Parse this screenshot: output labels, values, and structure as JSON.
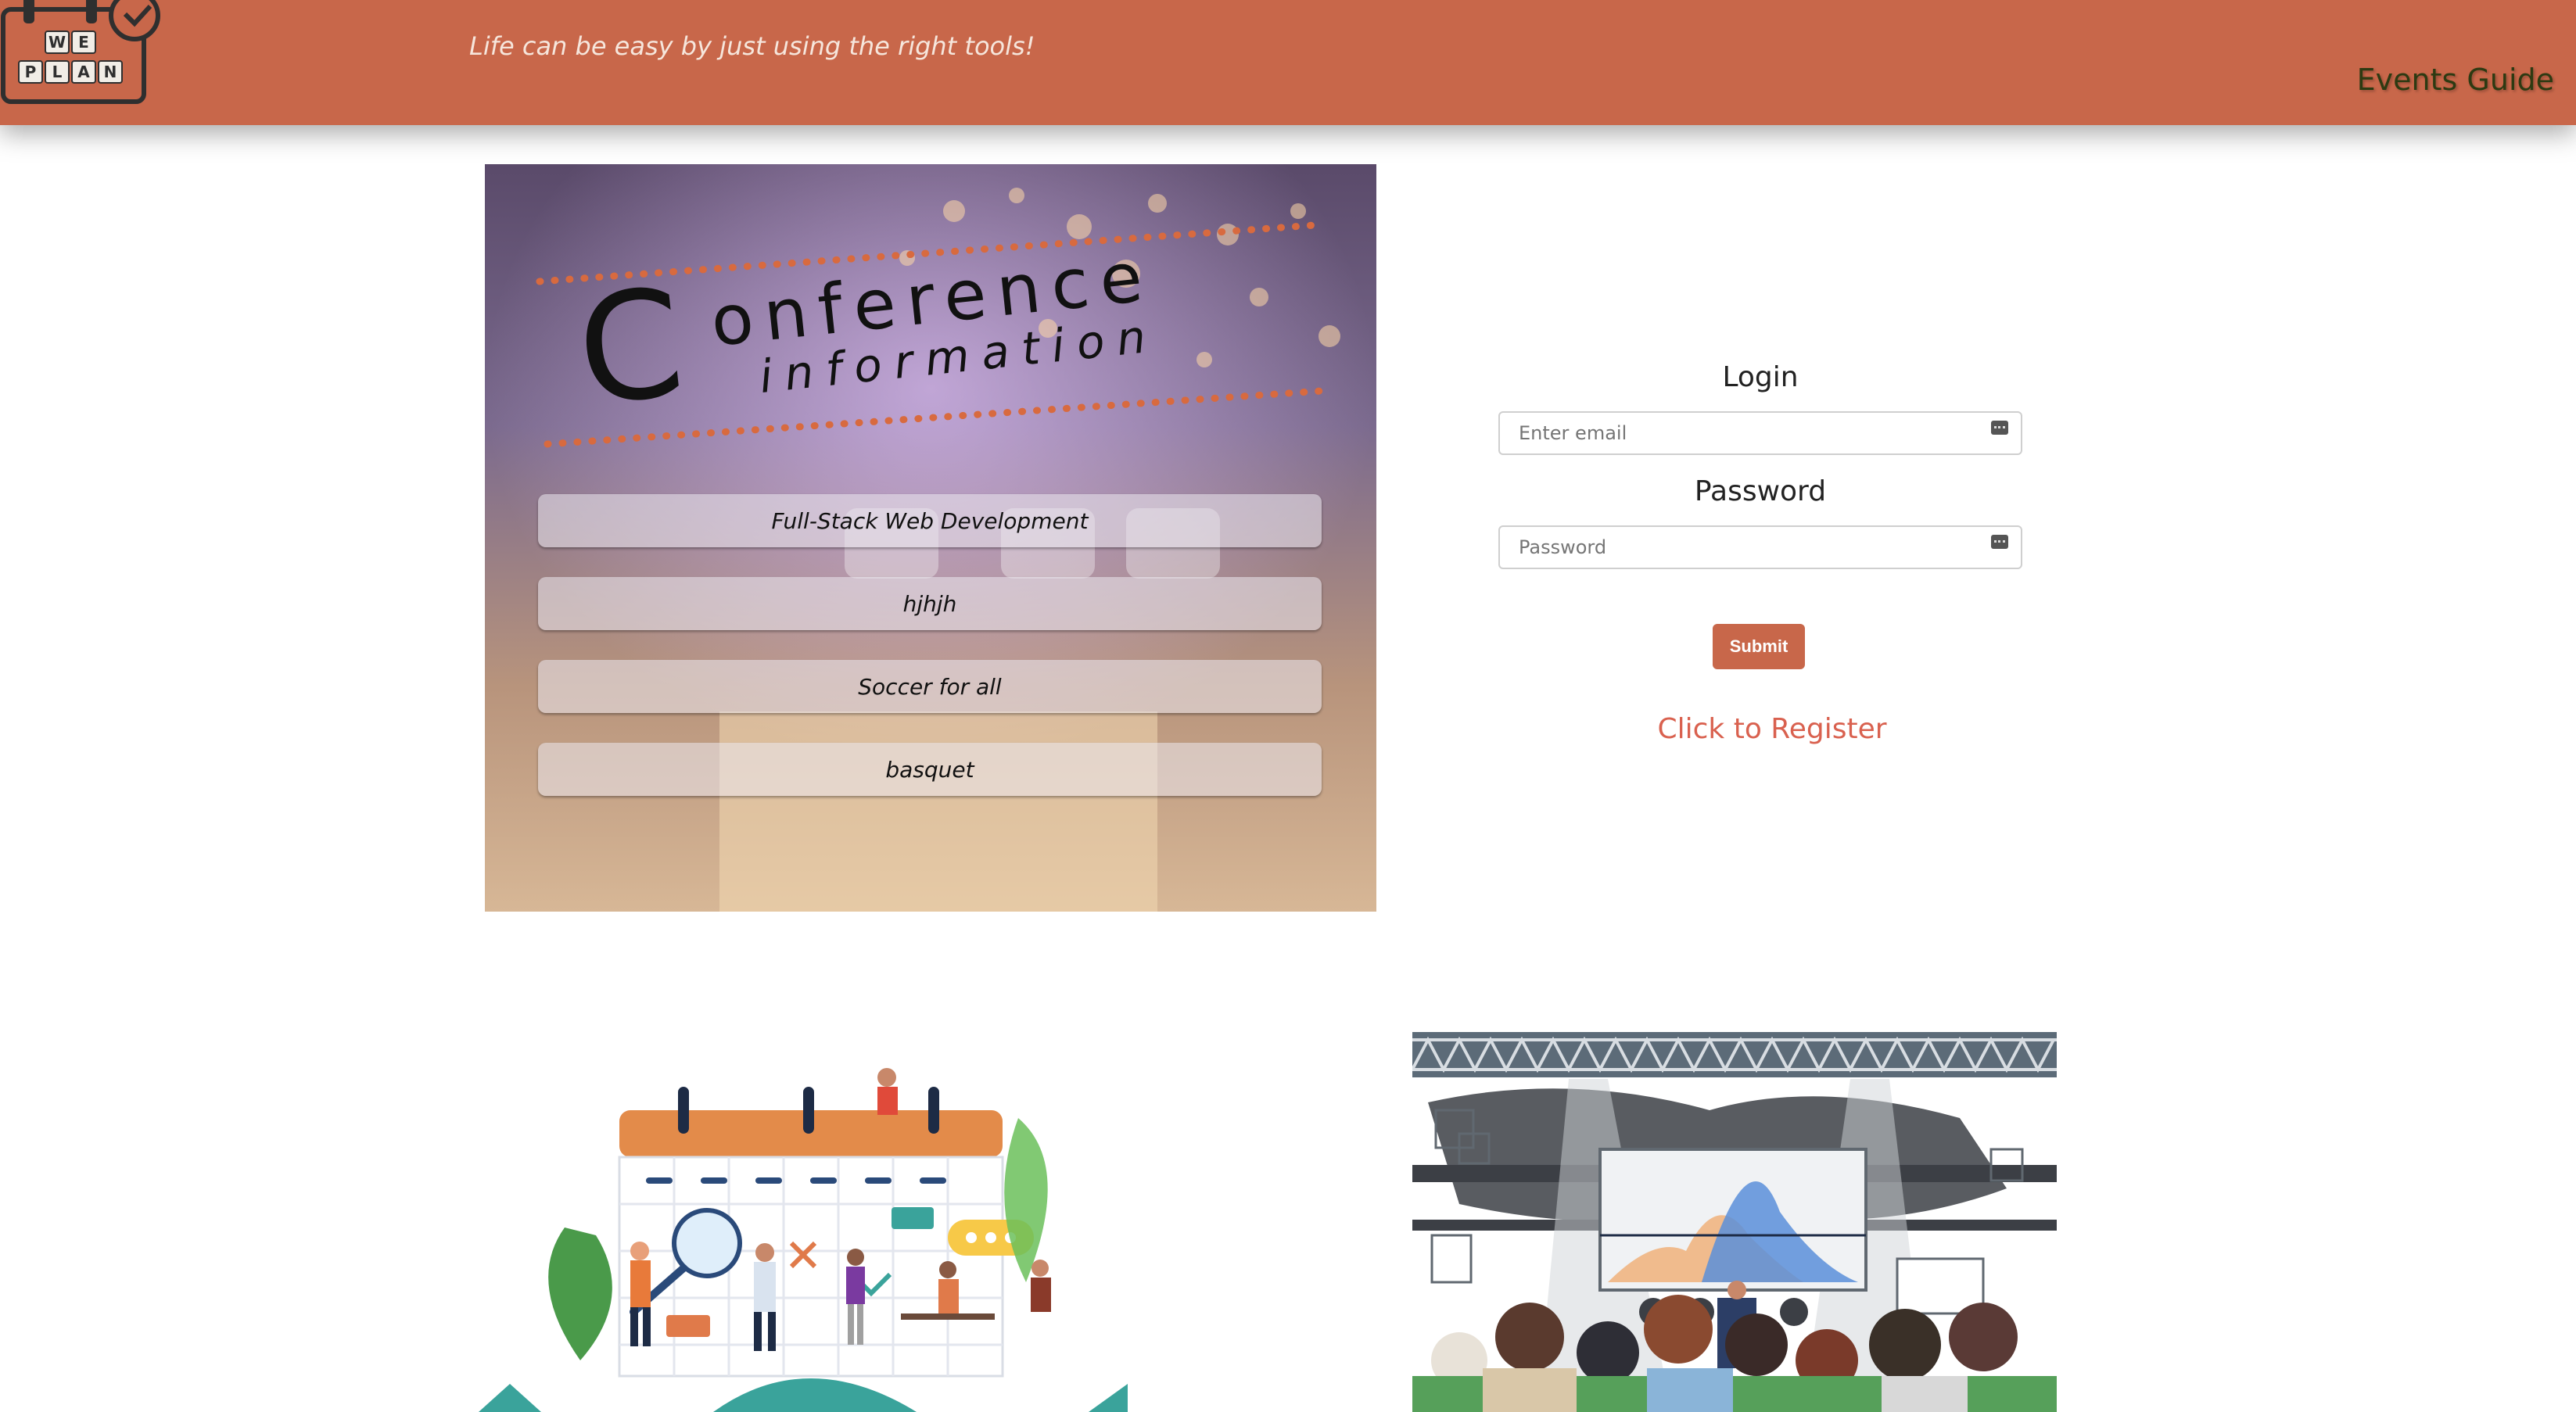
{
  "header": {
    "logo_words": [
      "WE",
      "PLAN"
    ],
    "tagline": "Life can be easy by just using the right tools!",
    "nav_label": "Events Guide",
    "colors": {
      "bar": "#c8674a",
      "nav_text": "#2d3a12"
    }
  },
  "conference": {
    "title_big_letter": "C",
    "title_rest": "onference",
    "subtitle": "information",
    "events": [
      {
        "label": "Full-Stack Web Development"
      },
      {
        "label": "hjhjh"
      },
      {
        "label": "Soccer for all"
      },
      {
        "label": "basquet"
      }
    ]
  },
  "login": {
    "login_label": "Login",
    "email_placeholder": "Enter email",
    "password_label": "Password",
    "password_placeholder": "Password",
    "submit_label": "Submit",
    "register_link": "Click to Register",
    "accent": "#c8674a",
    "link_color": "#d9614f"
  }
}
